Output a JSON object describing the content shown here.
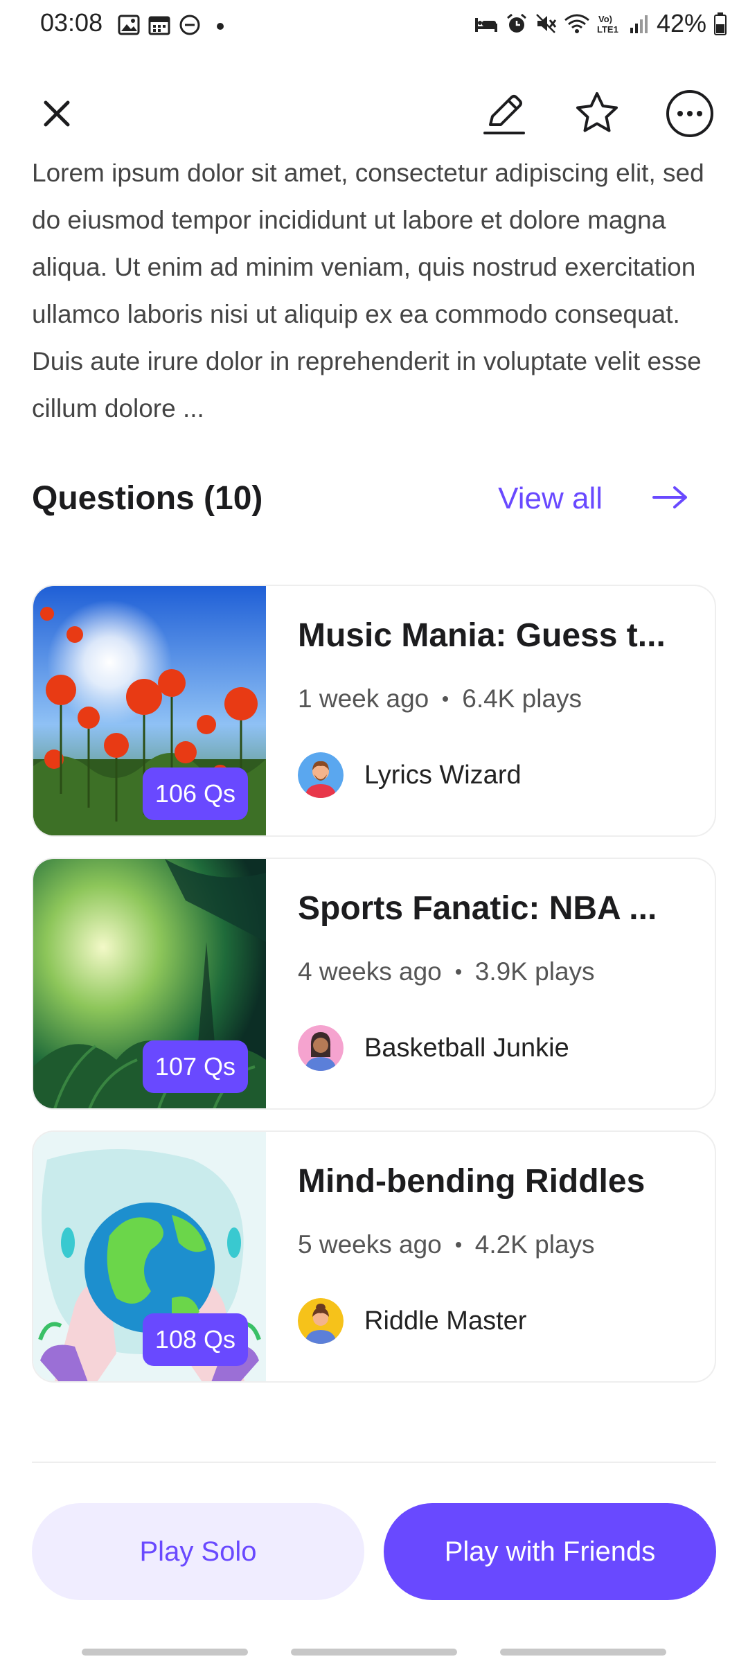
{
  "status_bar": {
    "time": "03:08",
    "battery": "42%",
    "icons_left": [
      "gallery-icon",
      "calendar-icon",
      "dnd-icon",
      "dot-icon"
    ],
    "icons_right": [
      "sleep-icon",
      "alarm-icon",
      "mute-icon",
      "wifi-icon",
      "volte-icon",
      "signal-icon",
      "battery-icon"
    ]
  },
  "app_bar": {
    "icons": [
      "close-icon",
      "edit-icon",
      "star-icon",
      "more-icon"
    ]
  },
  "description": "Lorem ipsum dolor sit amet, consectetur adipiscing elit, sed do eiusmod tempor incididunt ut labore et dolore magna aliqua. Ut enim ad minim veniam, quis nostrud exercitation ullamco laboris nisi ut aliquip ex ea commodo consequat. Duis aute irure dolor in reprehenderit in voluptate velit esse cillum dolore ...",
  "questions": {
    "title": "Questions (10)",
    "view_all": "View all",
    "items": [
      {
        "title": "Music Mania: Guess t...",
        "time": "1 week ago",
        "plays": "6.4K plays",
        "author": "Lyrics Wizard",
        "badge": "106 Qs"
      },
      {
        "title": "Sports Fanatic: NBA ...",
        "time": "4 weeks ago",
        "plays": "3.9K plays",
        "author": "Basketball Junkie",
        "badge": "107 Qs"
      },
      {
        "title": "Mind-bending Riddles",
        "time": "5 weeks ago",
        "plays": "4.2K plays",
        "author": "Riddle Master",
        "badge": "108 Qs"
      }
    ]
  },
  "actions": {
    "play_solo": "Play Solo",
    "play_friends": "Play with Friends"
  },
  "colors": {
    "accent": "#6949ff",
    "accent_light": "#f0edff"
  }
}
